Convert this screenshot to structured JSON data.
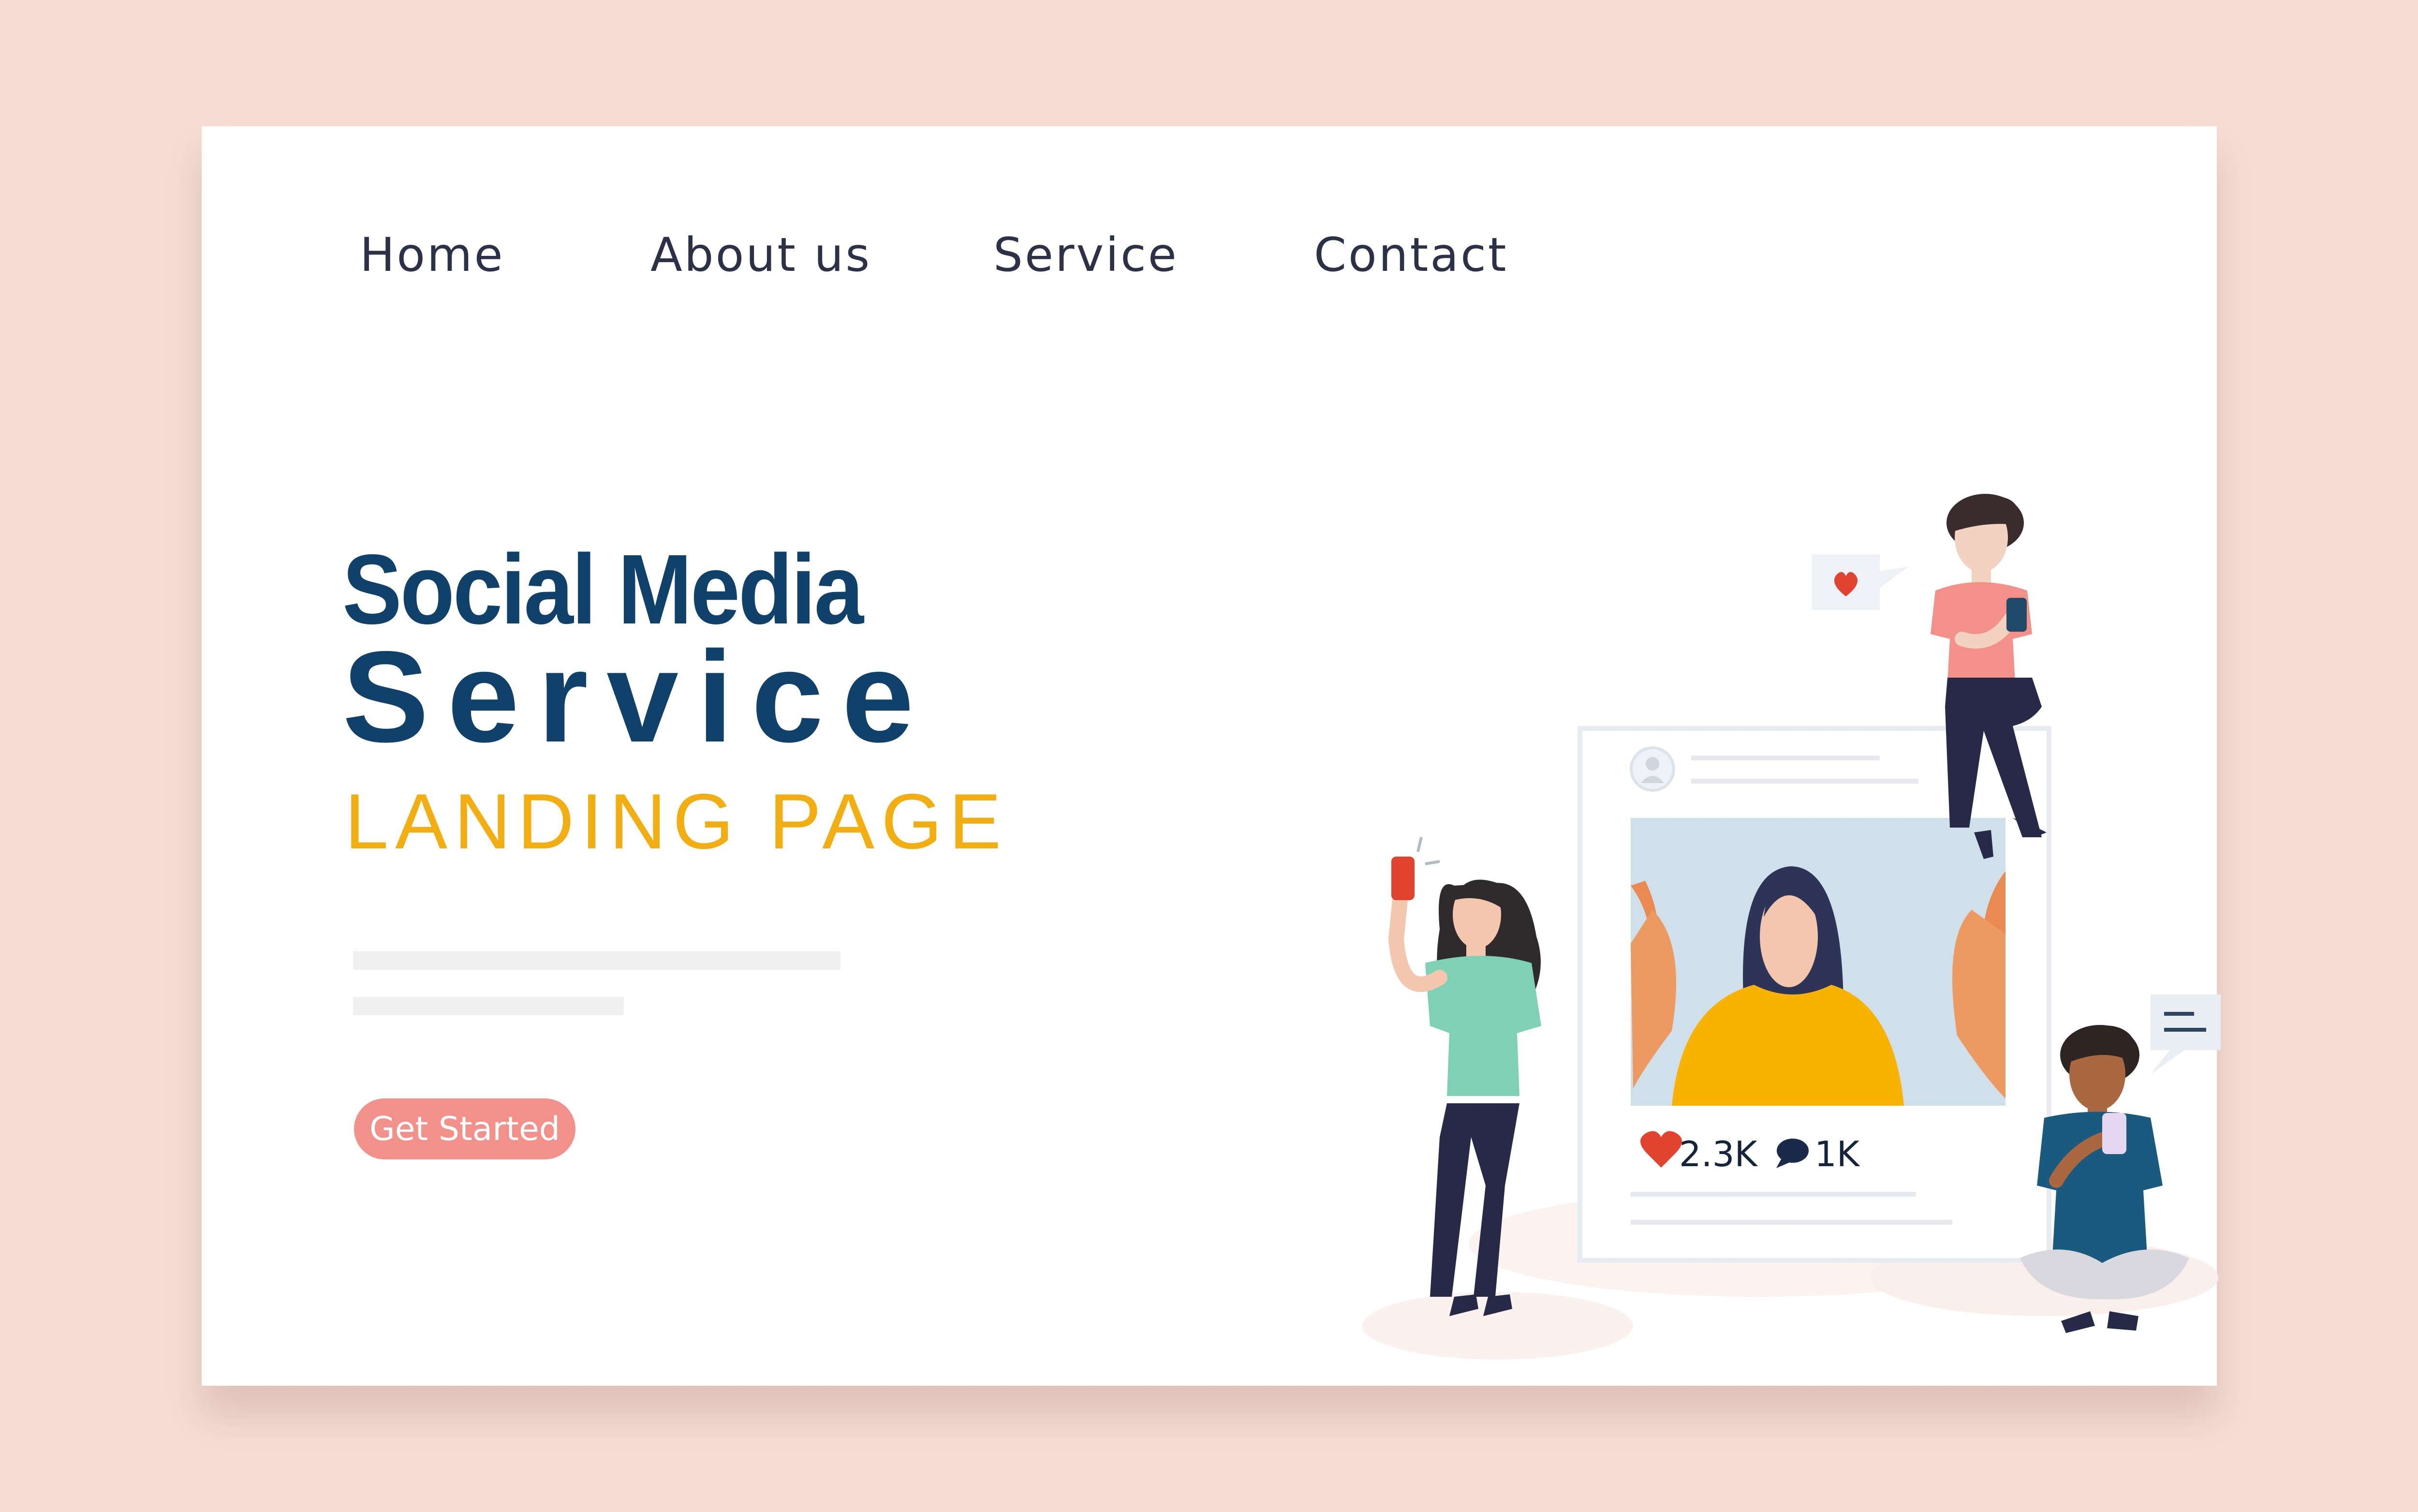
{
  "nav": {
    "items": [
      {
        "label": "Home"
      },
      {
        "label": "About us"
      },
      {
        "label": "Service"
      },
      {
        "label": "Contact"
      }
    ]
  },
  "hero": {
    "title_line1": "Social Media",
    "title_line2": "Service",
    "subtitle": "LANDING PAGE",
    "cta_label": "Get Started"
  },
  "post": {
    "likes": "2.3K",
    "comments": "1K"
  },
  "colors": {
    "page_bg": "#f6dcd3",
    "title_blue": "#0f416a",
    "accent_yellow": "#f2ae10",
    "cta_pink": "#f2908a",
    "heart_red": "#e0432f"
  },
  "icons": [
    "heart-icon",
    "comment-icon",
    "avatar-icon",
    "message-bubble-icon",
    "like-bubble-icon"
  ]
}
